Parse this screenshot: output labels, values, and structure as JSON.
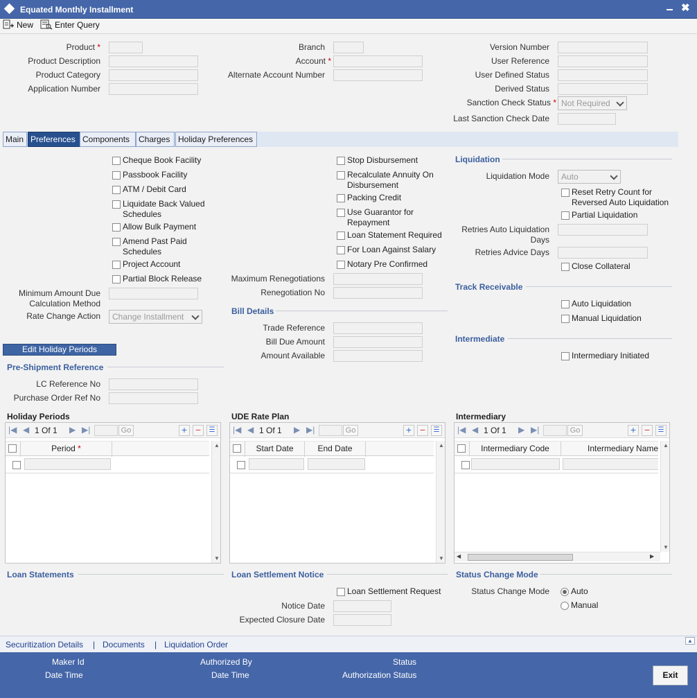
{
  "window": {
    "title": "Equated Monthly Installment",
    "minimize": "▬",
    "close": "✖"
  },
  "toolbar": {
    "new": "New",
    "enter_query": "Enter Query"
  },
  "header": {
    "product": "Product",
    "product_desc": "Product Description",
    "product_cat": "Product Category",
    "app_no": "Application Number",
    "branch": "Branch",
    "account": "Account",
    "alt_account": "Alternate Account Number",
    "version": "Version Number",
    "user_ref": "User Reference",
    "user_status": "User Defined Status",
    "derived_status": "Derived Status",
    "sanction_status": "Sanction Check Status",
    "sanction_value": "Not Required",
    "last_sanction": "Last Sanction Check Date",
    "req": "*"
  },
  "tabs": [
    "Main",
    "Preferences",
    "Components",
    "Charges",
    "Holiday Preferences"
  ],
  "prefs": {
    "col1": [
      "Cheque Book Facility",
      "Passbook Facility",
      "ATM / Debit Card",
      "Liquidate Back Valued",
      "Schedules",
      "Allow Bulk Payment",
      "Amend Past Paid",
      "Schedules",
      "Project Account",
      "Partial Block Release"
    ],
    "col2": [
      "Stop Disbursement",
      "Recalculate Annuity On",
      "Disbursement",
      "Packing Credit",
      "Use Guarantor for",
      "Repayment",
      "Loan Statement Required",
      "For Loan Against Salary",
      "Notary Pre Confirmed"
    ],
    "min_amount_1": "Minimum Amount Due",
    "min_amount_2": "Calculation Method",
    "rate_change": "Rate Change Action",
    "rate_change_value": "Change Installment",
    "max_reneg": "Maximum Renegotiations",
    "reneg_no": "Renegotiation No",
    "bill_details": "Bill Details",
    "trade_ref": "Trade Reference",
    "bill_due": "Bill Due Amount",
    "amount_avail": "Amount Available",
    "edit_holiday": "Edit Holiday Periods",
    "preship": "Pre-Shipment Reference",
    "lc_ref": "LC Reference No",
    "po_ref": "Purchase Order Ref No"
  },
  "liquidation": {
    "title": "Liquidation",
    "mode": "Liquidation Mode",
    "mode_value": "Auto",
    "reset_1": "Reset Retry Count for",
    "reset_2": "Reversed Auto Liquidation",
    "partial": "Partial Liquidation",
    "retries_1": "Retries Auto Liquidation",
    "retries_2": "Days",
    "retries_advice": "Retries Advice Days",
    "close_collateral": "Close Collateral",
    "track": "Track Receivable",
    "auto_liq": "Auto Liquidation",
    "manual_liq": "Manual Liquidation",
    "intermediate": "Intermediate",
    "inter_init": "Intermediary Initiated"
  },
  "grids": {
    "holiday": {
      "title": "Holiday Periods",
      "pager": "1 Of 1",
      "go": "Go",
      "cols": [
        "Period"
      ]
    },
    "ude": {
      "title": "UDE Rate Plan",
      "pager": "1 Of 1",
      "go": "Go",
      "cols": [
        "Start Date",
        "End Date"
      ]
    },
    "inter": {
      "title": "Intermediary",
      "pager": "1 Of 1",
      "go": "Go",
      "cols": [
        "Intermediary Code",
        "Intermediary Name"
      ]
    }
  },
  "bottom": {
    "loan_statements": "Loan Statements",
    "settlement": "Loan Settlement Notice",
    "settle_req": "Loan Settlement Request",
    "notice_date": "Notice Date",
    "expected_closure": "Expected Closure Date",
    "status_change": "Status Change Mode",
    "status_mode": "Status Change Mode",
    "auto": "Auto",
    "manual": "Manual"
  },
  "links": [
    "Securitization Details",
    "Documents",
    "Liquidation Order"
  ],
  "link_sep": "|",
  "footer": {
    "maker": "Maker Id",
    "datetime": "Date Time",
    "auth_by": "Authorized By",
    "status": "Status",
    "auth_status": "Authorization Status",
    "exit": "Exit"
  }
}
